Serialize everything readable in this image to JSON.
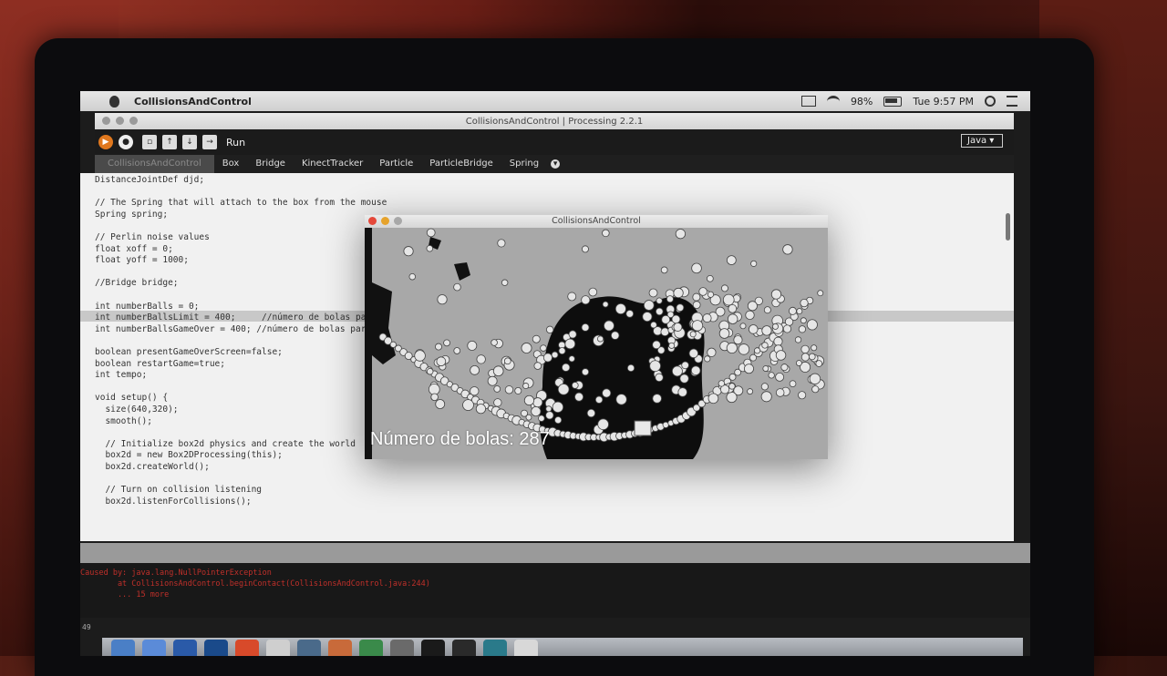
{
  "menubar": {
    "app_name": "CollisionsAndControl",
    "battery": "98%",
    "clock": "Tue 9:57 PM"
  },
  "window": {
    "title": "CollisionsAndControl | Processing 2.2.1"
  },
  "toolbar": {
    "run_label": "Run",
    "mode": "Java"
  },
  "tabs": [
    {
      "label": "CollisionsAndControl"
    },
    {
      "label": "Box"
    },
    {
      "label": "Bridge"
    },
    {
      "label": "KinectTracker"
    },
    {
      "label": "Particle"
    },
    {
      "label": "ParticleBridge"
    },
    {
      "label": "Spring"
    }
  ],
  "code": [
    "DistanceJointDef djd;",
    "",
    "// The Spring that will attach to the box from the mouse",
    "Spring spring;",
    "",
    "// Perlin noise values",
    "float xoff = 0;",
    "float yoff = 1000;",
    "",
    "//Bridge bridge;",
    "",
    "int numberBalls = 0;",
    "int numberBallsLimit = 400;     //número de bolas para",
    "int numberBallsGameOver = 400; //número de bolas para",
    "",
    "boolean presentGameOverScreen=false;",
    "boolean restartGame=true;",
    "int tempo;",
    "",
    "void setup() {",
    "  size(640,320);",
    "  smooth();",
    "",
    "  // Initialize box2d physics and create the world",
    "  box2d = new Box2DProcessing(this);",
    "  box2d.createWorld();",
    "",
    "  // Turn on collision listening",
    "  box2d.listenForCollisions();"
  ],
  "sketch": {
    "title": "CollisionsAndControl",
    "counter_text": "Número de bolas: 287"
  },
  "console": {
    "line1": "Caused by: java.lang.NullPointerException",
    "line2": "        at CollisionsAndControl.beginContact(CollisionsAndControl.java:244)",
    "line3": "        ... 15 more",
    "line_number": "49"
  }
}
